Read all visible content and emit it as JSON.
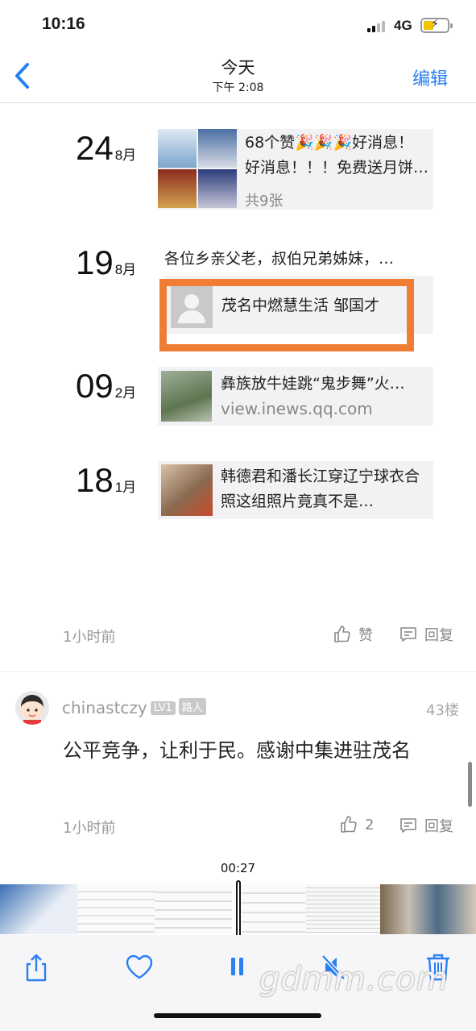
{
  "status_bar": {
    "time": "10:16",
    "network": "4G"
  },
  "nav": {
    "title": "今天",
    "subtitle": "下午 2:08",
    "edit_label": "编辑"
  },
  "timeline": [
    {
      "day": "24",
      "month": "8月",
      "text": "68个赞🎉🎉🎉好消息！好消息！！！免费送月饼…",
      "sub": "共9张"
    },
    {
      "day": "19",
      "month": "8月",
      "text": "各位乡亲父老，叔伯兄弟姊妹，…",
      "link_text": "茂名中燃慧生活 邹国才"
    },
    {
      "day": "09",
      "month": "2月",
      "text": "彝族放牛娃跳“鬼步舞”火…",
      "sub": "view.inews.qq.com"
    },
    {
      "day": "18",
      "month": "1月",
      "text": "韩德君和潘长江穿辽宁球衣合照这组照片竟真不是…"
    }
  ],
  "post_meta": {
    "time": "1小时前",
    "like_label": "赞",
    "reply_label": "回复"
  },
  "comment": {
    "username": "chinastczy",
    "level": "LV1",
    "tag": "路人",
    "floor": "43楼",
    "text": "公平竞争，让利于民。感谢中集进驻茂名",
    "time": "1小时前",
    "like_count": "2",
    "reply_label": "回复"
  },
  "video": {
    "timestamp": "00:27"
  },
  "watermark": "gdmm.com",
  "colors": {
    "accent": "#2a7ff3",
    "highlight_box": "#ef7d36",
    "toolbar_icon": "#2a7ff3"
  }
}
